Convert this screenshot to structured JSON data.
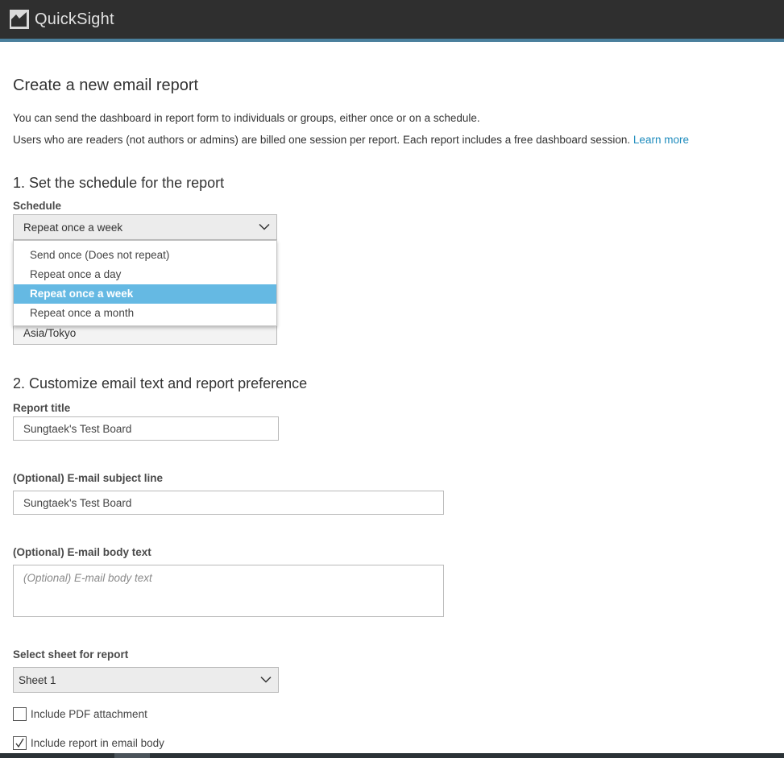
{
  "app": {
    "name": "QuickSight",
    "logo_icon": "quicksight-logo-icon"
  },
  "page": {
    "title": "Create a new email report",
    "intro_line1": "You can send the dashboard in report form to individuals or groups, either once or on a schedule.",
    "intro_line2": "Users who are readers (not authors or admins) are billed one session per report. Each report includes a free dashboard session.",
    "learn_more": "Learn more"
  },
  "section1": {
    "heading": "1. Set the schedule for the report",
    "schedule_label": "Schedule",
    "schedule_value": "Repeat once a week",
    "schedule_options": [
      {
        "label": "Send once (Does not repeat)",
        "selected": false
      },
      {
        "label": "Repeat once a day",
        "selected": false
      },
      {
        "label": "Repeat once a week",
        "selected": true
      },
      {
        "label": "Repeat once a month",
        "selected": false
      }
    ],
    "timezone_value": "Asia/Tokyo"
  },
  "section2": {
    "heading": "2. Customize email text and report preference",
    "report_title_label": "Report title",
    "report_title_value": "Sungtaek's Test Board",
    "subject_label": "(Optional) E-mail subject line",
    "subject_value": "Sungtaek's Test Board",
    "body_label": "(Optional) E-mail body text",
    "body_placeholder": "(Optional) E-mail body text",
    "sheet_label": "Select sheet for report",
    "sheet_value": "Sheet 1",
    "include_pdf_label": "Include PDF attachment",
    "include_pdf_checked": false,
    "include_body_label": "Include report in email body",
    "include_body_checked": true
  },
  "colors": {
    "topbar": "#2f2f2f",
    "accent_line": "#4a7f9c",
    "link": "#1e8bbd",
    "dropdown_selected": "#65b9e3"
  }
}
